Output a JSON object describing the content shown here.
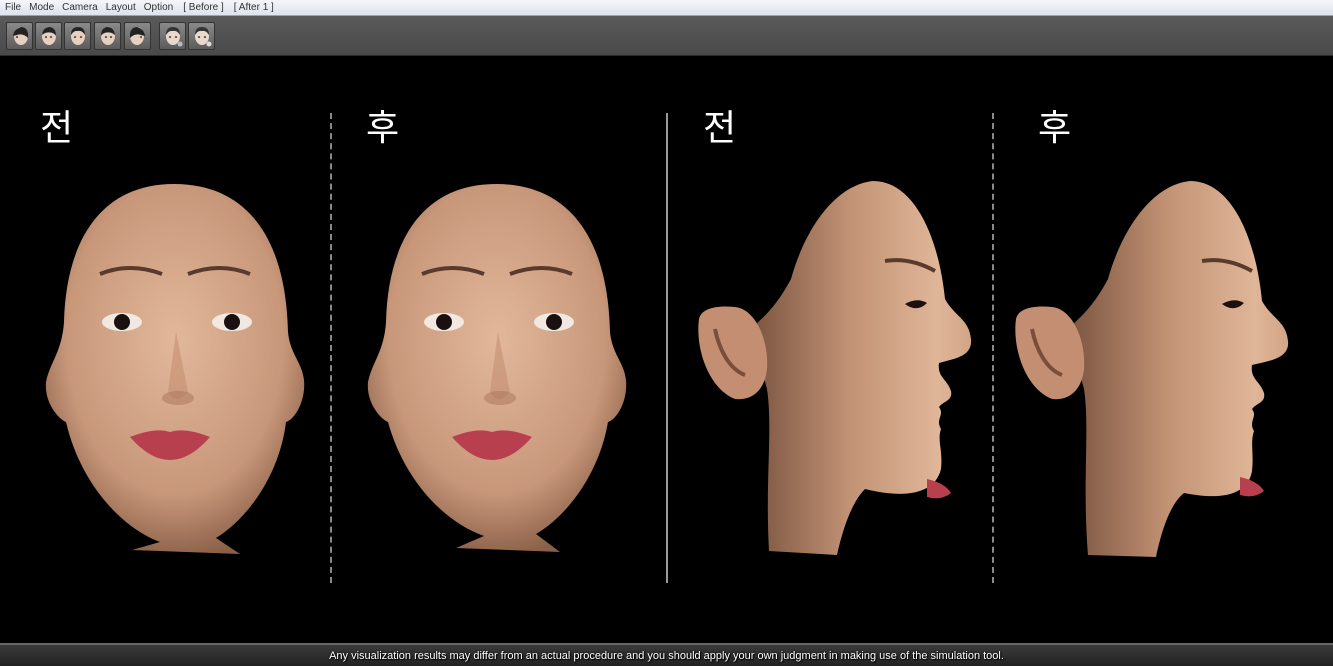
{
  "menu": {
    "items": [
      {
        "label": "File"
      },
      {
        "label": "Mode"
      },
      {
        "label": "Camera"
      },
      {
        "label": "Layout"
      },
      {
        "label": "Option"
      },
      {
        "label": "[ Before ]"
      },
      {
        "label": "[ After 1 ]"
      }
    ]
  },
  "toolbar": {
    "buttons": [
      {
        "icon": "face-left-profile-icon"
      },
      {
        "icon": "face-left-three-quarter-icon"
      },
      {
        "icon": "face-front-icon"
      },
      {
        "icon": "face-right-three-quarter-icon"
      },
      {
        "icon": "face-right-profile-icon"
      },
      {
        "icon": "face-before-icon"
      },
      {
        "icon": "face-after-icon"
      }
    ]
  },
  "viewport": {
    "panels": [
      {
        "label": "전",
        "view": "front"
      },
      {
        "label": "후",
        "view": "front"
      },
      {
        "label": "전",
        "view": "right-profile"
      },
      {
        "label": "후",
        "view": "right-profile"
      }
    ]
  },
  "status": {
    "disclaimer": "Any visualization results may differ from an actual procedure and you should apply your own judgment in making use of the simulation tool."
  },
  "colors": {
    "skin": "#d9ae90",
    "skin_shadow": "#a87a60",
    "lips": "#b8404e",
    "background": "#000000"
  }
}
